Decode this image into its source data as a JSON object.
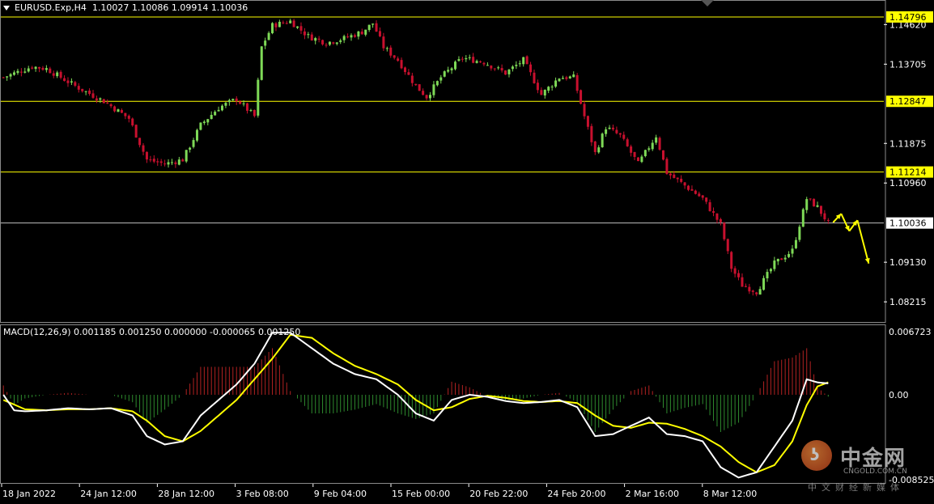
{
  "header": {
    "symbol": "EURUSD.Exp,H4",
    "ohlc": "1.10027 1.10086 1.09914 1.10036",
    "macd": "MACD(12,26,9) 0.001185 0.001250 0.000000 -0.000065 0.001250"
  },
  "colors": {
    "background": "#000000",
    "bull_candle": "#7ed957",
    "bear_candle": "#c8102e",
    "level_line": "#ffff00",
    "price_line": "#c0c0c0",
    "macd_line": "#ffffff",
    "signal_line": "#ffff00",
    "hist_pos": "#b22222",
    "hist_neg": "#2e8b2e",
    "arrow": "#ffff00"
  },
  "watermark": {
    "brand": "中金网",
    "url": "CNGOLD.COM.CN",
    "sub": "中文财经新媒体",
    "logo_icon": "coin-logo-icon"
  },
  "chart_data": [
    {
      "type": "candlestick",
      "title": "EURUSD.Exp,H4",
      "price_scale_ticks": [
        "1.14620",
        "1.13705",
        "1.11875",
        "1.10960",
        "1.09130",
        "1.08215"
      ],
      "ylim": [
        1.0775,
        1.1515
      ],
      "horizontal_levels": [
        {
          "label": "1.14796",
          "value": 1.14796,
          "kind": "resistance"
        },
        {
          "label": "1.12847",
          "value": 1.12847,
          "kind": "resistance"
        },
        {
          "label": "1.11214",
          "value": 1.11214,
          "kind": "resistance"
        },
        {
          "label": "1.10036",
          "value": 1.10036,
          "kind": "current-price"
        }
      ],
      "time_axis_labels": [
        "18 Jan 2022",
        "24 Jan 12:00",
        "28 Jan 12:00",
        "3 Feb 08:00",
        "9 Feb 04:00",
        "15 Feb 00:00",
        "20 Feb 22:00",
        "24 Feb 20:00",
        "2 Mar 16:00",
        "8 Mar 12:00"
      ],
      "anchors": [
        [
          0,
          1.134
        ],
        [
          8,
          1.1365
        ],
        [
          12,
          1.136
        ],
        [
          20,
          1.132
        ],
        [
          28,
          1.1285
        ],
        [
          35,
          1.1245
        ],
        [
          40,
          1.115
        ],
        [
          45,
          1.114
        ],
        [
          50,
          1.115
        ],
        [
          55,
          1.123
        ],
        [
          60,
          1.127
        ],
        [
          65,
          1.129
        ],
        [
          70,
          1.125
        ],
        [
          72,
          1.141
        ],
        [
          75,
          1.146
        ],
        [
          80,
          1.147
        ],
        [
          85,
          1.1435
        ],
        [
          90,
          1.142
        ],
        [
          95,
          1.143
        ],
        [
          100,
          1.1445
        ],
        [
          103,
          1.1465
        ],
        [
          106,
          1.141
        ],
        [
          110,
          1.138
        ],
        [
          115,
          1.132
        ],
        [
          118,
          1.1295
        ],
        [
          122,
          1.134
        ],
        [
          128,
          1.1385
        ],
        [
          134,
          1.1375
        ],
        [
          140,
          1.135
        ],
        [
          145,
          1.138
        ],
        [
          150,
          1.13
        ],
        [
          155,
          1.134
        ],
        [
          159,
          1.134
        ],
        [
          162,
          1.125
        ],
        [
          165,
          1.1165
        ],
        [
          168,
          1.1225
        ],
        [
          172,
          1.1205
        ],
        [
          177,
          1.114
        ],
        [
          182,
          1.1205
        ],
        [
          185,
          1.112
        ],
        [
          190,
          1.109
        ],
        [
          195,
          1.106
        ],
        [
          200,
          1.1
        ],
        [
          203,
          1.09
        ],
        [
          206,
          1.086
        ],
        [
          210,
          1.0845
        ],
        [
          215,
          1.091
        ],
        [
          220,
          1.094
        ],
        [
          224,
          1.106
        ],
        [
          227,
          1.104
        ],
        [
          230,
          1.1003
        ]
      ],
      "projection": [
        {
          "from": 1.1005,
          "to": 1.1025
        },
        {
          "from": 1.1025,
          "to": 1.0985
        },
        {
          "from": 1.0985,
          "to": 1.101
        },
        {
          "from": 1.101,
          "to": 1.091
        }
      ]
    },
    {
      "type": "macd",
      "title": "MACD(12,26,9)",
      "params": [
        12,
        26,
        9
      ],
      "scale_ticks": [
        "0.006723",
        "0.00",
        "-0.008525"
      ],
      "ylim": [
        -0.008525,
        0.006723
      ],
      "macd": [
        [
          0,
          0.0
        ],
        [
          3,
          -0.0015
        ],
        [
          6,
          -0.0016
        ],
        [
          12,
          -0.0015
        ],
        [
          18,
          -0.0013
        ],
        [
          24,
          -0.0014
        ],
        [
          30,
          -0.0013
        ],
        [
          36,
          -0.002
        ],
        [
          40,
          -0.004
        ],
        [
          45,
          -0.0048
        ],
        [
          50,
          -0.0045
        ],
        [
          55,
          -0.002
        ],
        [
          60,
          -0.0005
        ],
        [
          65,
          0.001
        ],
        [
          70,
          0.003
        ],
        [
          75,
          0.006
        ],
        [
          80,
          0.006
        ],
        [
          86,
          0.0045
        ],
        [
          92,
          0.003
        ],
        [
          98,
          0.002
        ],
        [
          104,
          0.0015
        ],
        [
          110,
          0.0
        ],
        [
          115,
          -0.0018
        ],
        [
          120,
          -0.0025
        ],
        [
          125,
          -0.0005
        ],
        [
          130,
          0.0
        ],
        [
          135,
          -0.0002
        ],
        [
          140,
          -0.0006
        ],
        [
          145,
          -0.0008
        ],
        [
          150,
          -0.0007
        ],
        [
          155,
          -0.0005
        ],
        [
          160,
          -0.0012
        ],
        [
          165,
          -0.004
        ],
        [
          170,
          -0.0038
        ],
        [
          175,
          -0.003
        ],
        [
          180,
          -0.0022
        ],
        [
          185,
          -0.0038
        ],
        [
          190,
          -0.004
        ],
        [
          195,
          -0.0045
        ],
        [
          200,
          -0.007
        ],
        [
          205,
          -0.008
        ],
        [
          210,
          -0.0075
        ],
        [
          215,
          -0.005
        ],
        [
          220,
          -0.0025
        ],
        [
          224,
          0.0015
        ],
        [
          227,
          0.0012
        ],
        [
          230,
          0.0011
        ]
      ],
      "signal": [
        [
          0,
          -0.0005
        ],
        [
          6,
          -0.0014
        ],
        [
          12,
          -0.0015
        ],
        [
          18,
          -0.0014
        ],
        [
          24,
          -0.0014
        ],
        [
          30,
          -0.0013
        ],
        [
          36,
          -0.0016
        ],
        [
          40,
          -0.0025
        ],
        [
          45,
          -0.004
        ],
        [
          50,
          -0.0045
        ],
        [
          55,
          -0.0035
        ],
        [
          60,
          -0.002
        ],
        [
          65,
          -0.0005
        ],
        [
          70,
          0.0015
        ],
        [
          75,
          0.0035
        ],
        [
          80,
          0.0058
        ],
        [
          86,
          0.0055
        ],
        [
          92,
          0.004
        ],
        [
          98,
          0.0028
        ],
        [
          104,
          0.002
        ],
        [
          110,
          0.001
        ],
        [
          115,
          -0.0005
        ],
        [
          120,
          -0.0015
        ],
        [
          125,
          -0.0012
        ],
        [
          130,
          -0.0004
        ],
        [
          135,
          -0.0001
        ],
        [
          140,
          -0.0003
        ],
        [
          145,
          -0.0006
        ],
        [
          150,
          -0.0007
        ],
        [
          155,
          -0.0006
        ],
        [
          160,
          -0.0008
        ],
        [
          165,
          -0.002
        ],
        [
          170,
          -0.003
        ],
        [
          175,
          -0.0032
        ],
        [
          180,
          -0.0027
        ],
        [
          185,
          -0.0028
        ],
        [
          190,
          -0.0033
        ],
        [
          195,
          -0.004
        ],
        [
          200,
          -0.005
        ],
        [
          205,
          -0.0065
        ],
        [
          210,
          -0.0075
        ],
        [
          215,
          -0.0068
        ],
        [
          220,
          -0.0045
        ],
        [
          224,
          -0.001
        ],
        [
          227,
          0.0008
        ],
        [
          230,
          0.0012
        ]
      ]
    }
  ]
}
